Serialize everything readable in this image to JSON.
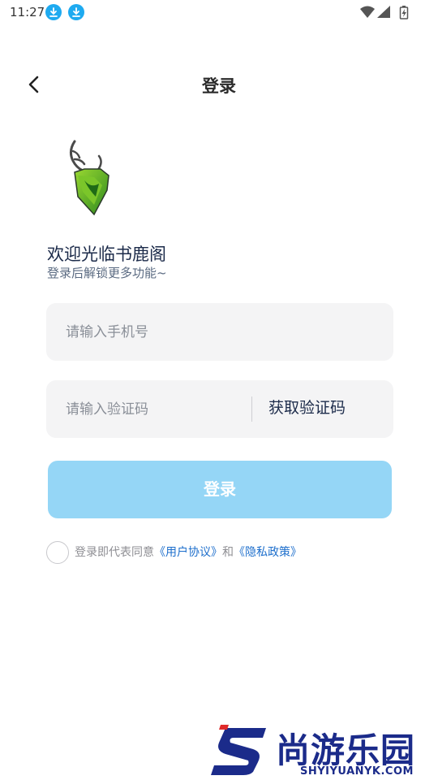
{
  "status_bar": {
    "time": "11:27",
    "icons": [
      "download-icon",
      "download-icon",
      "wifi-icon",
      "signal-icon",
      "battery-icon"
    ]
  },
  "header": {
    "title": "登录",
    "back_icon": "chevron-left-icon"
  },
  "brand": {
    "logo": "deer-logo",
    "welcome_title": "欢迎光临书鹿阁",
    "welcome_subtitle": "登录后解锁更多功能~"
  },
  "form": {
    "phone_placeholder": "请输入手机号",
    "code_placeholder": "请输入验证码",
    "get_code_label": "获取验证码",
    "login_label": "登录"
  },
  "agreement": {
    "prefix": "登录即代表同意",
    "user_agreement": "《用户协议》",
    "conjunction": "和",
    "privacy_policy": "《隐私政策》"
  },
  "watermark": {
    "title": "尚游乐园",
    "url": "SHYIYUANYK.COM"
  },
  "colors": {
    "accent_blue": "#1eaaf0",
    "login_button": "#95d6f6",
    "link": "#1e6fcc",
    "input_bg": "#f4f4f5"
  }
}
